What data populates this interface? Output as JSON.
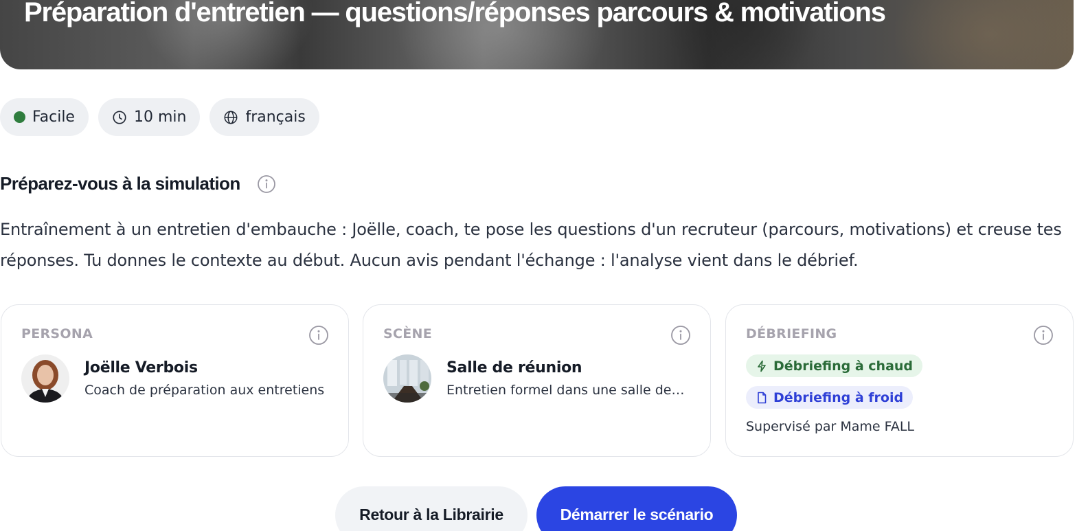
{
  "header": {
    "title": "Préparation d'entretien — questions/réponses parcours & motivations"
  },
  "meta_chips": [
    {
      "label": "Facile",
      "icon": "difficulty-dot-icon",
      "color": "#2f7d3e"
    },
    {
      "label": "10 min",
      "icon": "clock-icon"
    },
    {
      "label": "français",
      "icon": "globe-icon"
    }
  ],
  "prepare": {
    "title": "Préparez-vous à la simulation",
    "description": "Entraînement à un entretien d'embauche : Joëlle, coach, te pose les questions d'un recruteur (parcours, motivations) et creuse tes réponses. Tu donnes le contexte au début. Aucun avis pendant l'échange : l'analyse vient dans le débrief."
  },
  "cards": {
    "persona": {
      "label": "PERSONA",
      "name": "Joëlle Verbois",
      "role": "Coach de préparation aux entretiens"
    },
    "scene": {
      "label": "SCÈNE",
      "name": "Salle de réunion",
      "description": "Entretien formel dans une salle de réunion"
    },
    "debriefing": {
      "label": "DÉBRIEFING",
      "hot": "Débriefing à chaud",
      "cold": "Débriefing à froid",
      "supervisor": "Supervisé par Mame FALL"
    }
  },
  "actions": {
    "back_label": "Retour à la Librairie",
    "start_label": "Démarrer le scénario"
  },
  "colors": {
    "primary": "#2b45e3",
    "hot_bg": "#e6f5e9",
    "hot_fg": "#2a6b38",
    "cold_bg": "#eceefc",
    "cold_fg": "#2e3fd6"
  }
}
